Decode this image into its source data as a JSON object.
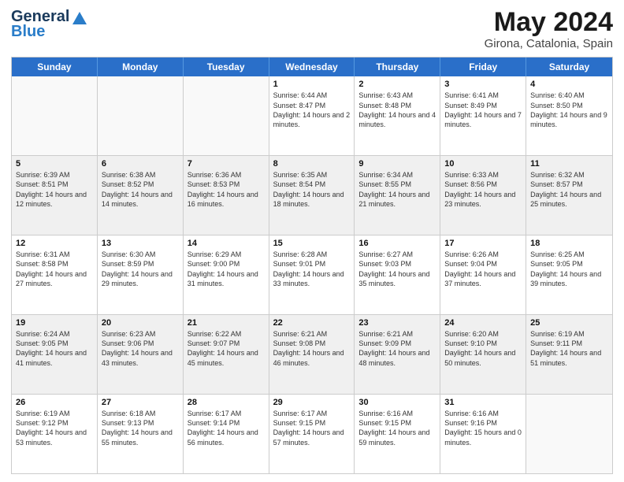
{
  "logo": {
    "line1": "General",
    "line2": "Blue"
  },
  "title": {
    "month_year": "May 2024",
    "location": "Girona, Catalonia, Spain"
  },
  "headers": [
    "Sunday",
    "Monday",
    "Tuesday",
    "Wednesday",
    "Thursday",
    "Friday",
    "Saturday"
  ],
  "rows": [
    [
      {
        "day": "",
        "empty": true
      },
      {
        "day": "",
        "empty": true
      },
      {
        "day": "",
        "empty": true
      },
      {
        "day": "1",
        "sunrise": "Sunrise: 6:44 AM",
        "sunset": "Sunset: 8:47 PM",
        "daylight": "Daylight: 14 hours and 2 minutes."
      },
      {
        "day": "2",
        "sunrise": "Sunrise: 6:43 AM",
        "sunset": "Sunset: 8:48 PM",
        "daylight": "Daylight: 14 hours and 4 minutes."
      },
      {
        "day": "3",
        "sunrise": "Sunrise: 6:41 AM",
        "sunset": "Sunset: 8:49 PM",
        "daylight": "Daylight: 14 hours and 7 minutes."
      },
      {
        "day": "4",
        "sunrise": "Sunrise: 6:40 AM",
        "sunset": "Sunset: 8:50 PM",
        "daylight": "Daylight: 14 hours and 9 minutes."
      }
    ],
    [
      {
        "day": "5",
        "sunrise": "Sunrise: 6:39 AM",
        "sunset": "Sunset: 8:51 PM",
        "daylight": "Daylight: 14 hours and 12 minutes."
      },
      {
        "day": "6",
        "sunrise": "Sunrise: 6:38 AM",
        "sunset": "Sunset: 8:52 PM",
        "daylight": "Daylight: 14 hours and 14 minutes."
      },
      {
        "day": "7",
        "sunrise": "Sunrise: 6:36 AM",
        "sunset": "Sunset: 8:53 PM",
        "daylight": "Daylight: 14 hours and 16 minutes."
      },
      {
        "day": "8",
        "sunrise": "Sunrise: 6:35 AM",
        "sunset": "Sunset: 8:54 PM",
        "daylight": "Daylight: 14 hours and 18 minutes."
      },
      {
        "day": "9",
        "sunrise": "Sunrise: 6:34 AM",
        "sunset": "Sunset: 8:55 PM",
        "daylight": "Daylight: 14 hours and 21 minutes."
      },
      {
        "day": "10",
        "sunrise": "Sunrise: 6:33 AM",
        "sunset": "Sunset: 8:56 PM",
        "daylight": "Daylight: 14 hours and 23 minutes."
      },
      {
        "day": "11",
        "sunrise": "Sunrise: 6:32 AM",
        "sunset": "Sunset: 8:57 PM",
        "daylight": "Daylight: 14 hours and 25 minutes."
      }
    ],
    [
      {
        "day": "12",
        "sunrise": "Sunrise: 6:31 AM",
        "sunset": "Sunset: 8:58 PM",
        "daylight": "Daylight: 14 hours and 27 minutes."
      },
      {
        "day": "13",
        "sunrise": "Sunrise: 6:30 AM",
        "sunset": "Sunset: 8:59 PM",
        "daylight": "Daylight: 14 hours and 29 minutes."
      },
      {
        "day": "14",
        "sunrise": "Sunrise: 6:29 AM",
        "sunset": "Sunset: 9:00 PM",
        "daylight": "Daylight: 14 hours and 31 minutes."
      },
      {
        "day": "15",
        "sunrise": "Sunrise: 6:28 AM",
        "sunset": "Sunset: 9:01 PM",
        "daylight": "Daylight: 14 hours and 33 minutes."
      },
      {
        "day": "16",
        "sunrise": "Sunrise: 6:27 AM",
        "sunset": "Sunset: 9:03 PM",
        "daylight": "Daylight: 14 hours and 35 minutes."
      },
      {
        "day": "17",
        "sunrise": "Sunrise: 6:26 AM",
        "sunset": "Sunset: 9:04 PM",
        "daylight": "Daylight: 14 hours and 37 minutes."
      },
      {
        "day": "18",
        "sunrise": "Sunrise: 6:25 AM",
        "sunset": "Sunset: 9:05 PM",
        "daylight": "Daylight: 14 hours and 39 minutes."
      }
    ],
    [
      {
        "day": "19",
        "sunrise": "Sunrise: 6:24 AM",
        "sunset": "Sunset: 9:05 PM",
        "daylight": "Daylight: 14 hours and 41 minutes."
      },
      {
        "day": "20",
        "sunrise": "Sunrise: 6:23 AM",
        "sunset": "Sunset: 9:06 PM",
        "daylight": "Daylight: 14 hours and 43 minutes."
      },
      {
        "day": "21",
        "sunrise": "Sunrise: 6:22 AM",
        "sunset": "Sunset: 9:07 PM",
        "daylight": "Daylight: 14 hours and 45 minutes."
      },
      {
        "day": "22",
        "sunrise": "Sunrise: 6:21 AM",
        "sunset": "Sunset: 9:08 PM",
        "daylight": "Daylight: 14 hours and 46 minutes."
      },
      {
        "day": "23",
        "sunrise": "Sunrise: 6:21 AM",
        "sunset": "Sunset: 9:09 PM",
        "daylight": "Daylight: 14 hours and 48 minutes."
      },
      {
        "day": "24",
        "sunrise": "Sunrise: 6:20 AM",
        "sunset": "Sunset: 9:10 PM",
        "daylight": "Daylight: 14 hours and 50 minutes."
      },
      {
        "day": "25",
        "sunrise": "Sunrise: 6:19 AM",
        "sunset": "Sunset: 9:11 PM",
        "daylight": "Daylight: 14 hours and 51 minutes."
      }
    ],
    [
      {
        "day": "26",
        "sunrise": "Sunrise: 6:19 AM",
        "sunset": "Sunset: 9:12 PM",
        "daylight": "Daylight: 14 hours and 53 minutes."
      },
      {
        "day": "27",
        "sunrise": "Sunrise: 6:18 AM",
        "sunset": "Sunset: 9:13 PM",
        "daylight": "Daylight: 14 hours and 55 minutes."
      },
      {
        "day": "28",
        "sunrise": "Sunrise: 6:17 AM",
        "sunset": "Sunset: 9:14 PM",
        "daylight": "Daylight: 14 hours and 56 minutes."
      },
      {
        "day": "29",
        "sunrise": "Sunrise: 6:17 AM",
        "sunset": "Sunset: 9:15 PM",
        "daylight": "Daylight: 14 hours and 57 minutes."
      },
      {
        "day": "30",
        "sunrise": "Sunrise: 6:16 AM",
        "sunset": "Sunset: 9:15 PM",
        "daylight": "Daylight: 14 hours and 59 minutes."
      },
      {
        "day": "31",
        "sunrise": "Sunrise: 6:16 AM",
        "sunset": "Sunset: 9:16 PM",
        "daylight": "Daylight: 15 hours and 0 minutes."
      },
      {
        "day": "",
        "empty": true
      }
    ]
  ]
}
